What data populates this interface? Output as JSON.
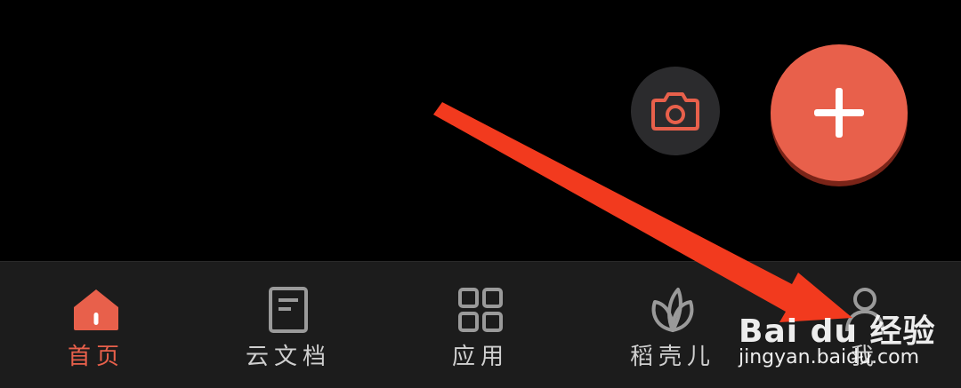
{
  "floating_actions": {
    "camera_icon": "camera-icon",
    "add_icon": "plus-icon"
  },
  "tabbar": {
    "tabs": [
      {
        "label": "首页",
        "icon": "home-icon",
        "active": true
      },
      {
        "label": "云文档",
        "icon": "document-icon",
        "active": false
      },
      {
        "label": "应用",
        "icon": "grid-icon",
        "active": false
      },
      {
        "label": "稻壳儿",
        "icon": "leaf-icon",
        "active": false
      },
      {
        "label": "我",
        "icon": "user-icon",
        "active": false
      }
    ]
  },
  "watermark": {
    "logo": "Bai du 经验",
    "url": "jingyan.baidu.com"
  },
  "colors": {
    "accent": "#e8604b",
    "background": "#000000",
    "tabbar_bg": "#1c1c1c",
    "annotation_arrow": "#f23a1e"
  }
}
